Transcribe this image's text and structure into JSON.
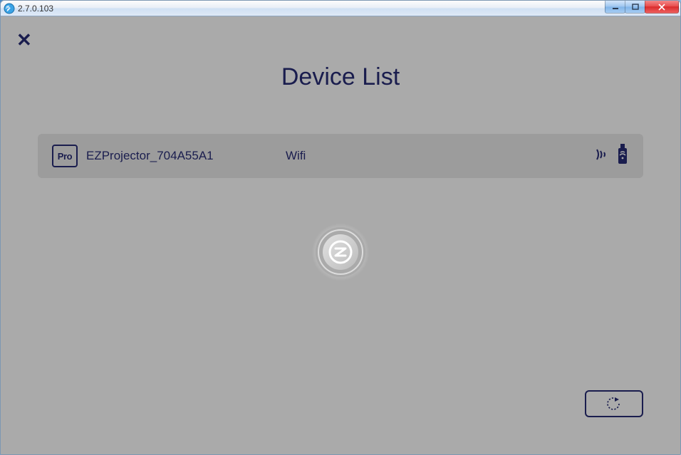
{
  "window": {
    "title": "2.7.0.103"
  },
  "page": {
    "title": "Device List",
    "close_x": "✕"
  },
  "devices": [
    {
      "badge": "Pro",
      "name": "EZProjector_704A55A1",
      "connection": "Wifi"
    }
  ],
  "buttons": {
    "refresh_aria": "Refresh"
  },
  "icons": {
    "signal": "signal-icon",
    "dongle": "dongle-icon",
    "spinner_letter": "Z"
  }
}
